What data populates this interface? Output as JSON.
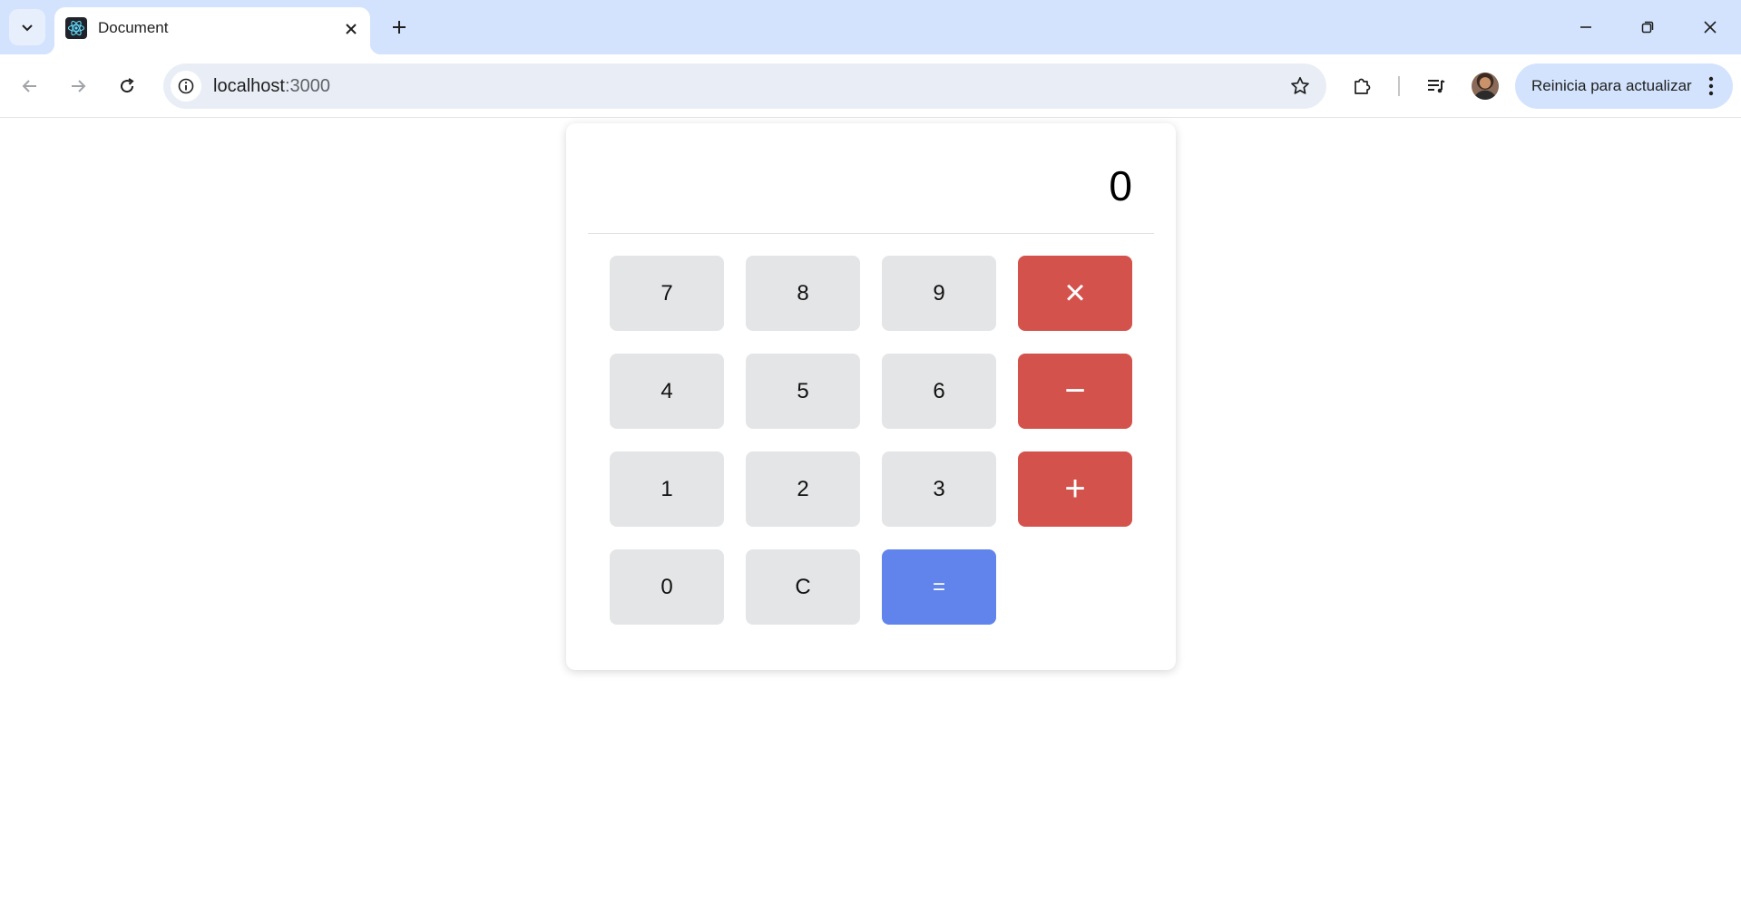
{
  "browser": {
    "tab": {
      "title": "Document",
      "favicon": "react-logo-icon"
    },
    "omnibox": {
      "host": "localhost",
      "port": ":3000"
    },
    "update_button": {
      "label": "Reinicia para actualizar"
    },
    "icons": {
      "tab_search": "chevron-down-icon",
      "tab_close": "close-icon",
      "new_tab": "plus-icon",
      "minimize": "minimize-icon",
      "restore": "restore-icon",
      "close_window": "close-icon",
      "back": "arrow-left-icon",
      "forward": "arrow-right-icon",
      "reload": "reload-icon",
      "site_info": "info-icon",
      "bookmark": "star-icon",
      "extensions": "puzzle-icon",
      "media": "media-queue-icon",
      "menu": "kebab-icon"
    }
  },
  "calculator": {
    "display": "0",
    "keys": [
      {
        "label": "7",
        "kind": "digit"
      },
      {
        "label": "8",
        "kind": "digit"
      },
      {
        "label": "9",
        "kind": "digit"
      },
      {
        "label": "×",
        "kind": "operator",
        "name": "multiply"
      },
      {
        "label": "4",
        "kind": "digit"
      },
      {
        "label": "5",
        "kind": "digit"
      },
      {
        "label": "6",
        "kind": "digit"
      },
      {
        "label": "−",
        "kind": "operator",
        "name": "subtract"
      },
      {
        "label": "1",
        "kind": "digit"
      },
      {
        "label": "2",
        "kind": "digit"
      },
      {
        "label": "3",
        "kind": "digit"
      },
      {
        "label": "+",
        "kind": "operator",
        "name": "add"
      },
      {
        "label": "0",
        "kind": "digit"
      },
      {
        "label": "C",
        "kind": "clear"
      },
      {
        "label": "=",
        "kind": "equals"
      }
    ],
    "colors": {
      "digit_key": "#e4e5e7",
      "operator_key": "#d4524c",
      "equals_key": "#6184ec"
    }
  }
}
